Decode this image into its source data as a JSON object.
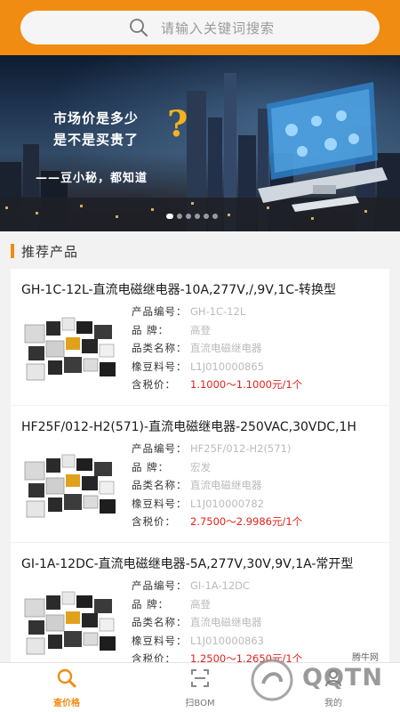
{
  "search": {
    "placeholder": "请输入关键词搜索"
  },
  "banner": {
    "line1": "市场价是多少",
    "line2": "是不是买贵了",
    "qmark": "?",
    "line3": "——豆小秘，都知道",
    "dots": 6,
    "active_dot": 0
  },
  "section": {
    "title": "推荐产品"
  },
  "labels": {
    "code": "产品编号：",
    "brand": "品      牌：",
    "category": "品类名称：",
    "bean_code": "橡豆料号：",
    "price": "含税价："
  },
  "products": [
    {
      "title": "GH-1C-12L-直流电磁继电器-10A,277V,/,9V,1C-转换型",
      "code": "GH-1C-12L",
      "brand": "高登",
      "category": "直流电磁继电器",
      "bean_code": "L1J010000865",
      "price": "1.1000～1.1000元/1个"
    },
    {
      "title": "HF25F/012-H2(571)-直流电磁继电器-250VAC,30VDC,1H",
      "code": "HF25F/012-H2(571)",
      "brand": "宏发",
      "category": "直流电磁继电器",
      "bean_code": "L1J010000782",
      "price": "2.7500～2.9986元/1个"
    },
    {
      "title": "GI-1A-12DC-直流电磁继电器-5A,277V,30V,9V,1A-常开型",
      "code": "GI-1A-12DC",
      "brand": "高登",
      "category": "直流电磁继电器",
      "bean_code": "L1J010000863",
      "price": "1.2500～1.2650元/1个"
    }
  ],
  "nav": {
    "items": [
      {
        "label": "查价格",
        "icon": "magnifier-icon",
        "active": true
      },
      {
        "label": "扫BOM",
        "icon": "scan-icon",
        "active": false
      },
      {
        "label": "我的",
        "icon": "user-icon",
        "active": false
      }
    ]
  },
  "watermark": {
    "text": "QQTN",
    "small": "腾牛网"
  },
  "colors": {
    "accent": "#f08c11",
    "price": "#e0231c"
  }
}
